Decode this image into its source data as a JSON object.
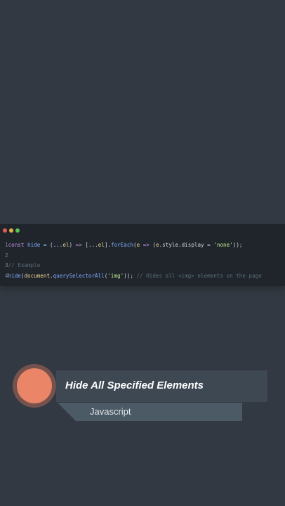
{
  "colors": {
    "background": "#333942",
    "code_bg": "#1f252b",
    "dot_red": "#e05b5b",
    "dot_yellow": "#e2b23e",
    "dot_green": "#58c45c",
    "accent_circle": "#ea8567",
    "title_bar": "#3e4853",
    "subtitle_bar": "#4b5a65"
  },
  "code_window": {
    "lines": [
      {
        "number": "1",
        "tokens": [
          {
            "t": "const",
            "c": "kw"
          },
          {
            "t": " ",
            "c": "pl"
          },
          {
            "t": "hide",
            "c": "fn"
          },
          {
            "t": " = ",
            "c": "op"
          },
          {
            "t": "(...",
            "c": "pl"
          },
          {
            "t": "el",
            "c": "vr"
          },
          {
            "t": ") ",
            "c": "pl"
          },
          {
            "t": "=>",
            "c": "kw"
          },
          {
            "t": " [...",
            "c": "pl"
          },
          {
            "t": "el",
            "c": "vr"
          },
          {
            "t": "].",
            "c": "pl"
          },
          {
            "t": "forEach",
            "c": "fn"
          },
          {
            "t": "(",
            "c": "pl"
          },
          {
            "t": "e",
            "c": "vr"
          },
          {
            "t": " ",
            "c": "pl"
          },
          {
            "t": "=>",
            "c": "kw"
          },
          {
            "t": " (",
            "c": "pl"
          },
          {
            "t": "e",
            "c": "vr"
          },
          {
            "t": ".style.display = ",
            "c": "pl"
          },
          {
            "t": "'none'",
            "c": "st"
          },
          {
            "t": "));",
            "c": "pl"
          }
        ]
      },
      {
        "number": "2",
        "tokens": []
      },
      {
        "number": "3",
        "tokens": [
          {
            "t": "// Example",
            "c": "cm"
          }
        ]
      },
      {
        "number": "4",
        "tokens": [
          {
            "t": "hide",
            "c": "fn"
          },
          {
            "t": "(",
            "c": "pl"
          },
          {
            "t": "document",
            "c": "vr"
          },
          {
            "t": ".",
            "c": "pl"
          },
          {
            "t": "querySelectorAll",
            "c": "fn"
          },
          {
            "t": "(",
            "c": "pl"
          },
          {
            "t": "'img'",
            "c": "st"
          },
          {
            "t": ")); ",
            "c": "pl"
          },
          {
            "t": "// Hides all <img> elements on the page",
            "c": "cm"
          }
        ]
      }
    ]
  },
  "banner": {
    "title": "Hide All Specified Elements",
    "subtitle": "Javascript"
  }
}
